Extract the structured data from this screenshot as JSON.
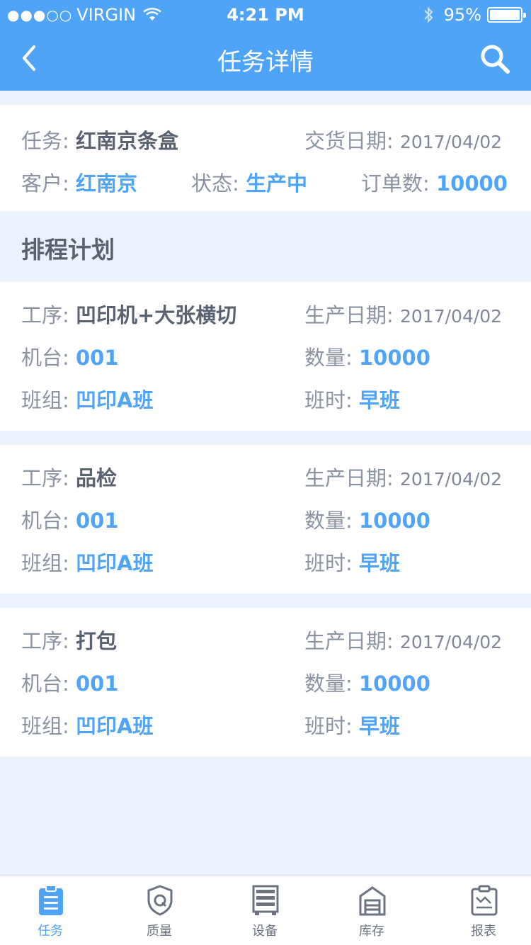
{
  "status_bar": {
    "signal_dots": "●●●○○",
    "carrier": "VIRGIN",
    "time": "4:21 PM",
    "battery": "95%"
  },
  "nav": {
    "title": "任务详情",
    "back_icon": "chevron-left-icon",
    "search_icon": "search-icon"
  },
  "task": {
    "task_label": "任务:",
    "task_value": "红南京条盒",
    "delivery_label": "交货日期:",
    "delivery_value": "2017/04/02",
    "customer_label": "客户:",
    "customer_value": "红南京",
    "state_label": "状态:",
    "state_value": "生产中",
    "orders_label": "订单数:",
    "orders_value": "10000"
  },
  "schedule": {
    "title": "排程计划",
    "items": [
      {
        "process_label": "工序:",
        "process_value": "凹印机+大张横切",
        "date_label": "生产日期:",
        "date_value": "2017/04/02",
        "machine_label": "机台:",
        "machine_value": "001",
        "qty_label": "数量:",
        "qty_value": "10000",
        "team_label": "班组:",
        "team_value": "凹印A班",
        "shift_label": "班时:",
        "shift_value": "早班"
      },
      {
        "process_label": "工序:",
        "process_value": "品检",
        "date_label": "生产日期:",
        "date_value": "2017/04/02",
        "machine_label": "机台:",
        "machine_value": "001",
        "qty_label": "数量:",
        "qty_value": "10000",
        "team_label": "班组:",
        "team_value": "凹印A班",
        "shift_label": "班时:",
        "shift_value": "早班"
      },
      {
        "process_label": "工序:",
        "process_value": "打包",
        "date_label": "生产日期:",
        "date_value": "2017/04/02",
        "machine_label": "机台:",
        "machine_value": "001",
        "qty_label": "数量:",
        "qty_value": "10000",
        "team_label": "班组:",
        "team_value": "凹印A班",
        "shift_label": "班时:",
        "shift_value": "早班"
      }
    ]
  },
  "tabbar": {
    "active_color": "#4fa4f8",
    "tabs": [
      {
        "label": "任务",
        "icon": "clipboard-list-icon",
        "active": true
      },
      {
        "label": "质量",
        "icon": "shield-q-icon",
        "active": false
      },
      {
        "label": "设备",
        "icon": "server-rack-icon",
        "active": false
      },
      {
        "label": "库存",
        "icon": "warehouse-icon",
        "active": false
      },
      {
        "label": "报表",
        "icon": "report-clipboard-icon",
        "active": false
      }
    ]
  },
  "colors": {
    "header": "#4fa4f8",
    "background": "#eaf2fc",
    "accent": "#4fa4f8"
  }
}
